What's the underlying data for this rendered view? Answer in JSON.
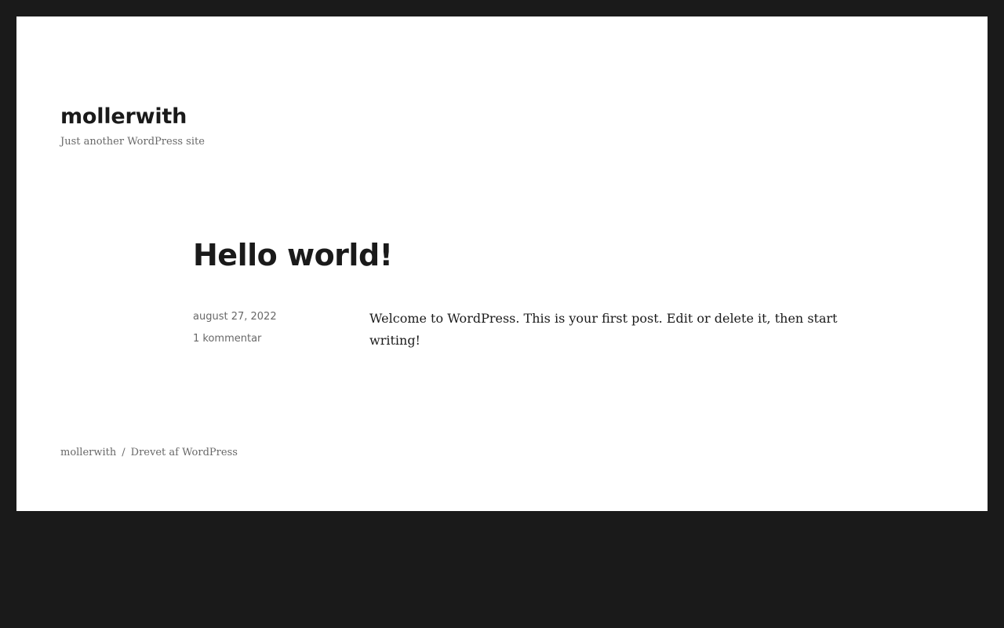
{
  "header": {
    "site_title": "mollerwith",
    "site_description": "Just another WordPress site"
  },
  "post": {
    "title": "Hello world!",
    "date": "august 27, 2022",
    "comments": "1 kommentar",
    "content": "Welcome to WordPress. This is your first post. Edit or delete it, then start writing!"
  },
  "footer": {
    "site_link": "mollerwith",
    "separator": "/",
    "powered_by": "Drevet af WordPress"
  },
  "colors": {
    "background": "#1a1a1a",
    "page": "#ffffff",
    "text": "#1a1a1a",
    "muted": "#686868"
  }
}
